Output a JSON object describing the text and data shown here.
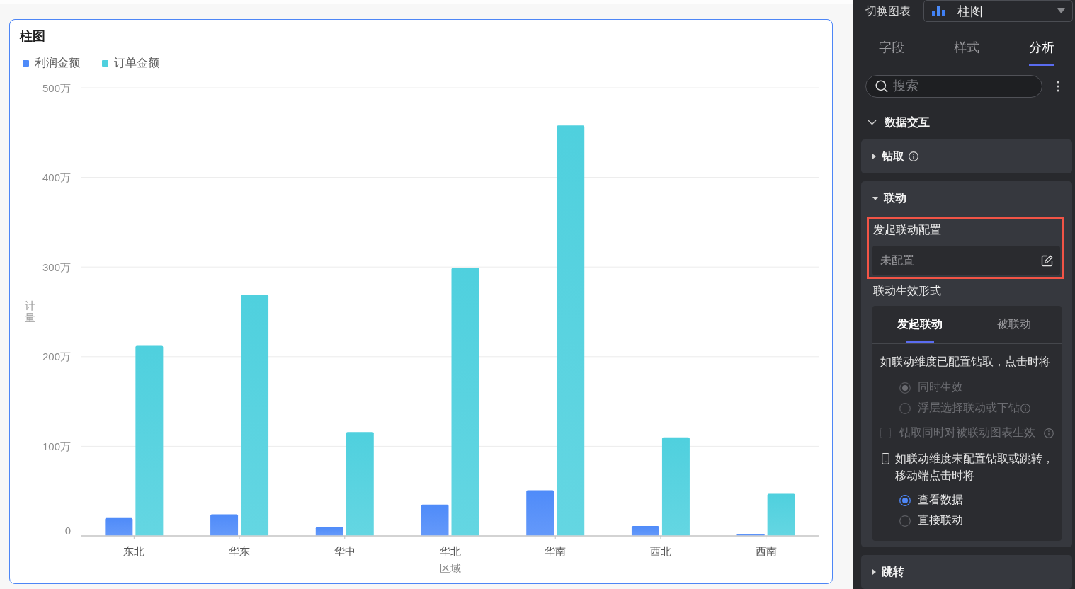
{
  "chart_card": {
    "selected": true,
    "chart_data": {
      "type": "bar",
      "title": "柱图",
      "legend": "top",
      "grid": true,
      "xlabel": "区域",
      "ylabel": "计量",
      "categories": [
        "东北",
        "华东",
        "华中",
        "华北",
        "华南",
        "西北",
        "西南"
      ],
      "series": [
        {
          "name": "利润金额",
          "color": "#4f8bf9",
          "values": [
            20,
            24,
            10,
            35,
            51,
            11,
            2
          ]
        },
        {
          "name": "订单金额",
          "color": "#4fd0de",
          "values": [
            212,
            269,
            116,
            299,
            458,
            110,
            47
          ]
        }
      ],
      "ylim": [
        0,
        500
      ],
      "yticks": [
        {
          "value": 0,
          "label": "0"
        },
        {
          "value": 100,
          "label": "100万"
        },
        {
          "value": 200,
          "label": "200万"
        },
        {
          "value": 300,
          "label": "300万"
        },
        {
          "value": 400,
          "label": "400万"
        },
        {
          "value": 500,
          "label": "500万"
        }
      ]
    }
  },
  "panel": {
    "chart_switch": {
      "label": "切换图表",
      "value": "柱图"
    },
    "tabs": [
      {
        "label": "字段",
        "selected": false
      },
      {
        "label": "样式",
        "selected": false
      },
      {
        "label": "分析",
        "selected": true
      }
    ],
    "search": {
      "placeholder": "搜索"
    },
    "section": {
      "title": "数据交互",
      "expanded": true,
      "groups": [
        {
          "title": "钻取",
          "info": true,
          "expanded": false
        },
        {
          "title": "联动",
          "info": false,
          "expanded": true,
          "config": {
            "label": "发起联动配置",
            "value": "未配置",
            "highlighted": true
          },
          "mode_label": "联动生效形式",
          "mode_tabs": [
            {
              "label": "发起联动",
              "selected": true
            },
            {
              "label": "被联动",
              "selected": false
            }
          ],
          "drill_note": "如联动维度已配置钻取，点击时将",
          "drill_options": [
            {
              "label": "同时生效",
              "selected": true,
              "disabled": true,
              "info": false
            },
            {
              "label": "浮层选择联动或下钻",
              "selected": false,
              "disabled": true,
              "info": true
            }
          ],
          "drill_sync": {
            "label": "钻取同时对被联动图表生效",
            "checked": false,
            "disabled": true,
            "info": true
          },
          "mobile_note": "如联动维度未配置钻取或跳转，移动端点击时将",
          "mobile_options": [
            {
              "label": "查看数据",
              "selected": true,
              "disabled": false
            },
            {
              "label": "直接联动",
              "selected": false,
              "disabled": false
            }
          ]
        },
        {
          "title": "跳转",
          "info": false,
          "expanded": false
        }
      ]
    }
  }
}
